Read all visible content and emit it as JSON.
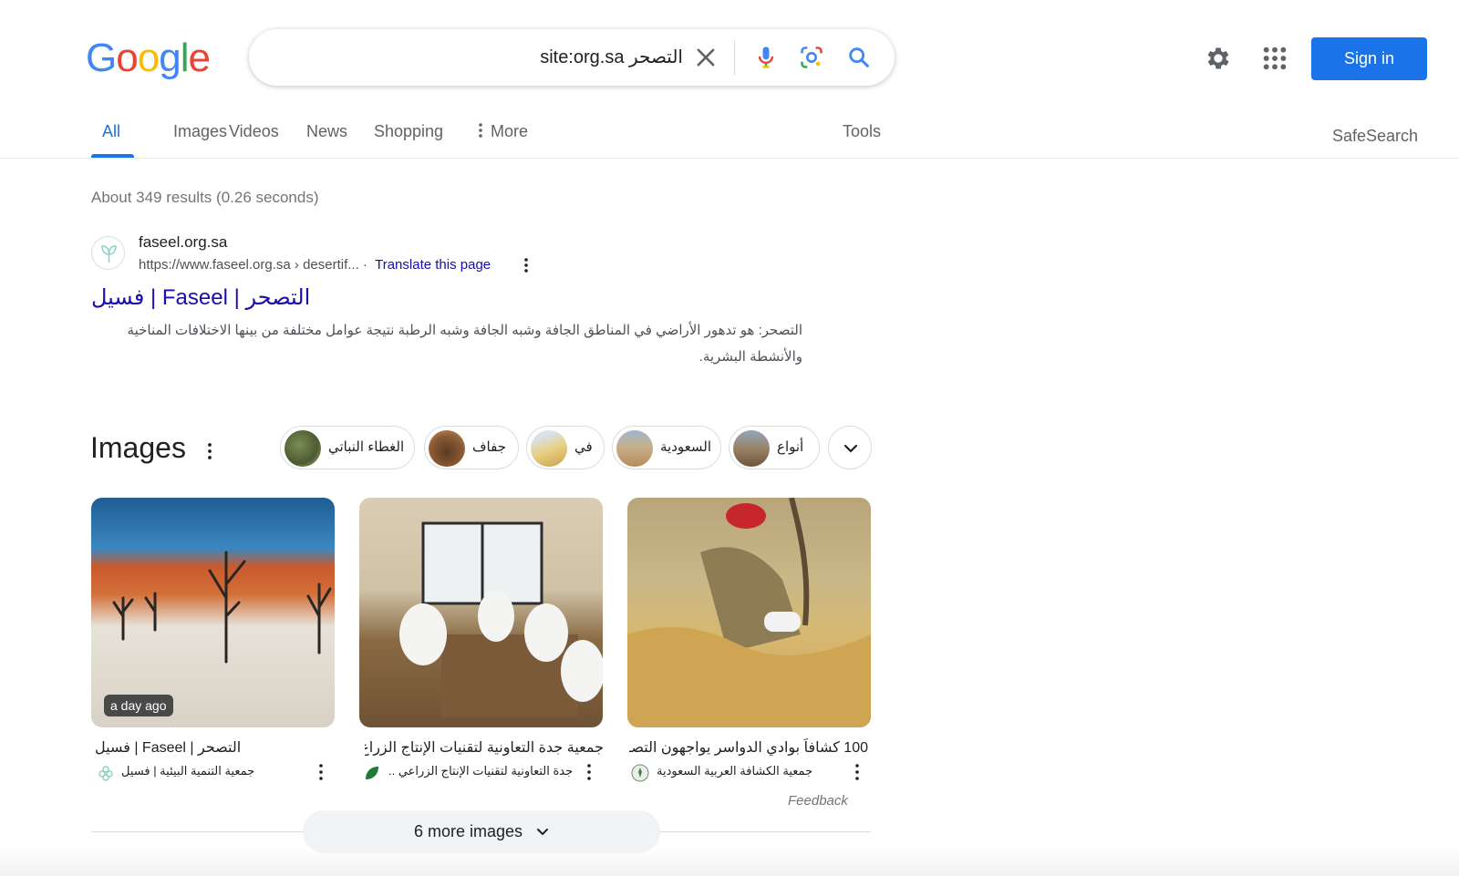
{
  "header": {
    "logo": [
      "G",
      "o",
      "o",
      "g",
      "l",
      "e"
    ],
    "logo_colors": [
      "#4285f4",
      "#ea4335",
      "#fbbc05",
      "#4285f4",
      "#34a853",
      "#ea4335"
    ],
    "search_query": "site:org.sa التصحر",
    "sign_in_label": "Sign in",
    "icons": [
      "close-icon",
      "mic-icon",
      "lens-icon",
      "search-icon",
      "gear-icon",
      "apps-grid-icon"
    ]
  },
  "tabs": {
    "items": [
      "All",
      "Images",
      "Videos",
      "News",
      "Shopping"
    ],
    "more_label": "More",
    "active": "All",
    "tools_label": "Tools",
    "safesearch_label": "SafeSearch"
  },
  "stats": "About 349 results (0.26 seconds)",
  "result": {
    "site_name": "faseel.org.sa",
    "url": "https://www.faseel.org.sa › desertif... ·",
    "translate_label": "Translate this page",
    "title": "التصحر | Faseel | فسيل",
    "snippet": "التصحر: هو تدهور الأراضي في المناطق الجافة وشبه الجافة وشبه الرطبة نتيجة عوامل مختلفة من بينها الاختلافات المناخية والأنشطة البشرية."
  },
  "images": {
    "heading": "Images",
    "chips": [
      "الغطاء النباتي",
      "جفاف",
      "في",
      "السعودية",
      "أنواع"
    ],
    "cards": [
      {
        "title": "التصحر | Faseel | فسيل",
        "source": "جمعية التنمية البيئية | فسيل",
        "badge": "a day ago"
      },
      {
        "title": "جمعية جدة التعاونية لتقنيات الإنتاج الزراع...",
        "source": "جدة التعاونية لتقنيات الإنتاج الزراعي ..",
        "badge": ""
      },
      {
        "title": "100 كشافاً بوادي الدواسر يواجهون التصـ ...",
        "source": "جمعية الكشافة العربية السعودية",
        "badge": ""
      }
    ],
    "feedback_label": "Feedback",
    "more_images_label": "6 more images"
  },
  "colors": {
    "accent": "#1a73e8",
    "link": "#1a0dab",
    "muted": "#70757a"
  }
}
